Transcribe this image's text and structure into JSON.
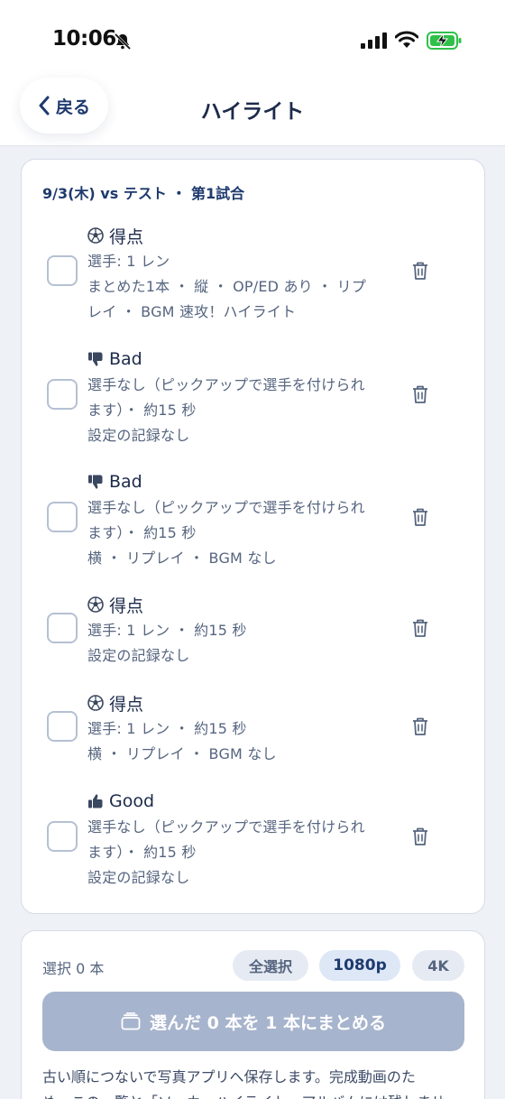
{
  "status_bar": {
    "time": "10:06"
  },
  "nav": {
    "back_label": "戻る",
    "title": "ハイライト"
  },
  "match": {
    "title": "9/3(木) vs テスト ・ 第1試合"
  },
  "clips": [
    {
      "icon": "soccer-ball-icon",
      "label": "得点",
      "lines": [
        "選手: 1 レン",
        "まとめた1本 ・ 縦 ・ OP/ED あり ・ リプ",
        "レイ ・ BGM 速攻！ハイライト"
      ]
    },
    {
      "icon": "thumbs-down-icon",
      "label": "Bad",
      "lines": [
        "選手なし（ピックアップで選手を付けられ",
        "ます）・ 約15 秒",
        "設定の記録なし"
      ]
    },
    {
      "icon": "thumbs-down-icon",
      "label": "Bad",
      "lines": [
        "選手なし（ピックアップで選手を付けられ",
        "ます）・ 約15 秒",
        "横 ・ リプレイ ・ BGM なし"
      ]
    },
    {
      "icon": "soccer-ball-icon",
      "label": "得点",
      "lines": [
        "選手: 1 レン ・ 約15 秒",
        "設定の記録なし"
      ]
    },
    {
      "icon": "soccer-ball-icon",
      "label": "得点",
      "lines": [
        "選手: 1 レン ・ 約15 秒",
        "横 ・ リプレイ ・ BGM なし"
      ]
    },
    {
      "icon": "thumbs-up-icon",
      "label": "Good",
      "lines": [
        "選手なし（ピックアップで選手を付けられ",
        "ます）・ 約15 秒",
        "設定の記録なし"
      ]
    }
  ],
  "merge": {
    "selection_count": "選択 0 本",
    "select_all": "全選択",
    "resolution_1080": "1080p",
    "resolution_4k": "4K",
    "merge_button": "選んだ 0 本を 1 本にまとめる",
    "note_line1": "古い順につないで写真アプリへ保存します。完成動画のた",
    "note_line2": "め、この一覧と「ソッカーハイライト」アルバムには残しませ"
  },
  "colors": {
    "accent": "#1e3a6e",
    "disabled_button": "#a7b4cd",
    "background": "#eef1f6"
  }
}
